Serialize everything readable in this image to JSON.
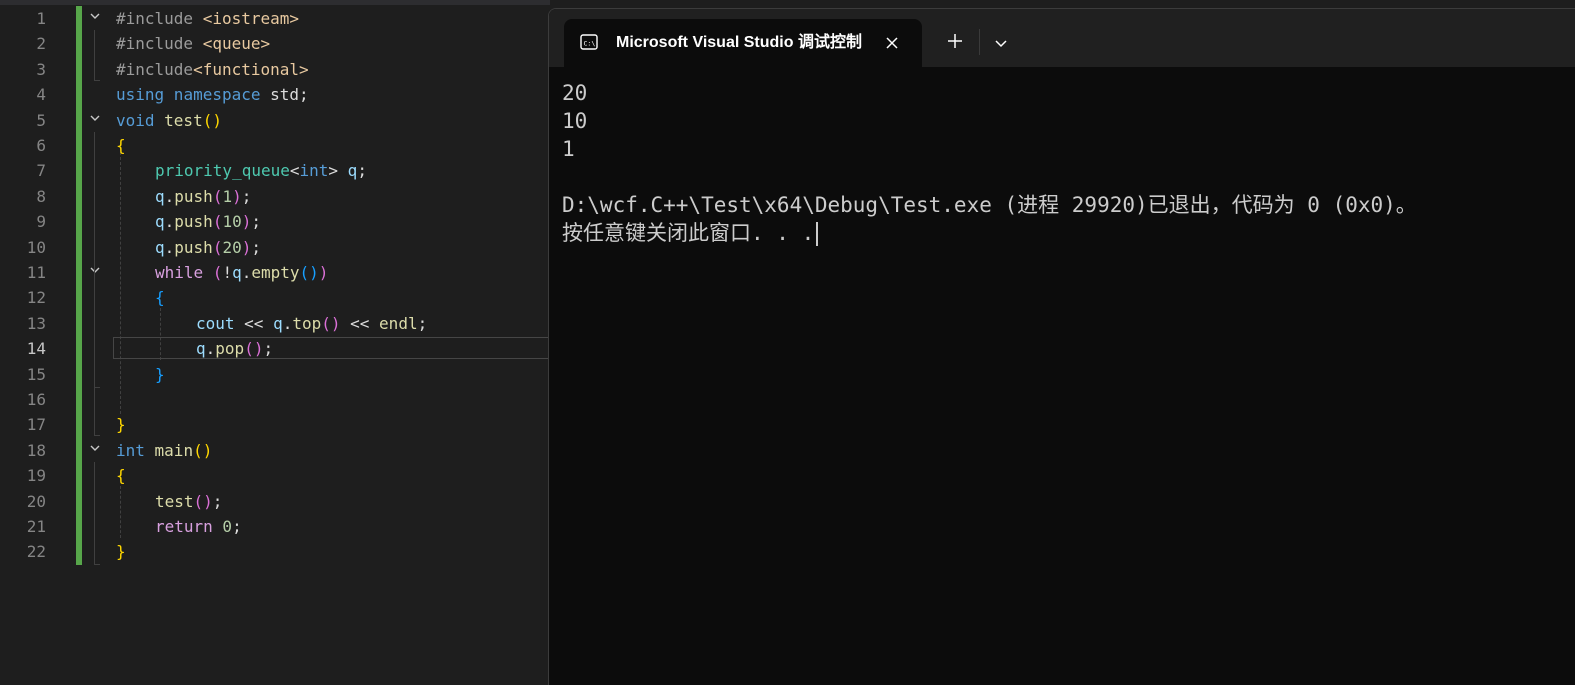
{
  "editor": {
    "line_numbers": [
      "1",
      "2",
      "3",
      "4",
      "5",
      "6",
      "7",
      "8",
      "9",
      "10",
      "11",
      "12",
      "13",
      "14",
      "15",
      "16",
      "17",
      "18",
      "19",
      "20",
      "21",
      "22"
    ],
    "code": {
      "l1_a": "#include ",
      "l1_b": "<iostream>",
      "l2_a": "#include ",
      "l2_b": "<queue>",
      "l3_a": "#include",
      "l3_b": "<functional>",
      "l4_a": "using",
      "l4_b": " namespace",
      "l4_c": " std;",
      "l5_a": "void",
      "l5_b": " test",
      "l5_c": "()",
      "l6": "{",
      "l7_a": "priority_queue",
      "l7_b": "<",
      "l7_c": "int",
      "l7_d": ">",
      "l7_e": " q",
      "l7_f": ";",
      "l8_a": "q",
      "l8_b": ".",
      "l8_c": "push",
      "l8_d": "(",
      "l8_e": "1",
      "l8_f": ")",
      "l8_g": ";",
      "l9_a": "q",
      "l9_b": ".",
      "l9_c": "push",
      "l9_d": "(",
      "l9_e": "10",
      "l9_f": ")",
      "l9_g": ";",
      "l10_a": "q",
      "l10_b": ".",
      "l10_c": "push",
      "l10_d": "(",
      "l10_e": "20",
      "l10_f": ")",
      "l10_g": ";",
      "l11_a": "while",
      "l11_b": " (",
      "l11_c": "!",
      "l11_d": "q",
      "l11_e": ".",
      "l11_f": "empty",
      "l11_g": "()",
      "l11_h": ")",
      "l12": "{",
      "l13_a": "cout",
      "l13_b": " << ",
      "l13_c": "q",
      "l13_d": ".",
      "l13_e": "top",
      "l13_f": "()",
      "l13_g": " << ",
      "l13_h": "endl",
      "l13_i": ";",
      "l14_a": "q",
      "l14_b": ".",
      "l14_c": "pop",
      "l14_d": "()",
      "l14_e": ";",
      "l15": "}",
      "l17": "}",
      "l18_a": "int",
      "l18_b": " main",
      "l18_c": "()",
      "l19": "{",
      "l20_a": "test",
      "l20_b": "()",
      "l20_c": ";",
      "l21_a": "return",
      "l21_b": " 0",
      "l21_c": ";",
      "l22": "}"
    },
    "current_line": "14"
  },
  "terminal": {
    "tab_title": "Microsoft Visual Studio 调试控制台",
    "tab_icon": "terminal-icon",
    "output": [
      "20",
      "10",
      "1",
      "",
      "D:\\wcf.C++\\Test\\x64\\Debug\\Test.exe (进程 29920)已退出，代码为 0 (0x0)。",
      "按任意键关闭此窗口. . ."
    ]
  },
  "colors": {
    "editor_bg": "#1e1e1e",
    "terminal_bg": "#0c0c0c",
    "change_bar": "#57a64a",
    "keyword": "#569cd6",
    "control": "#d8a0df",
    "function": "#dcdcaa",
    "type": "#4ec9b0",
    "variable": "#9cdcfe"
  }
}
